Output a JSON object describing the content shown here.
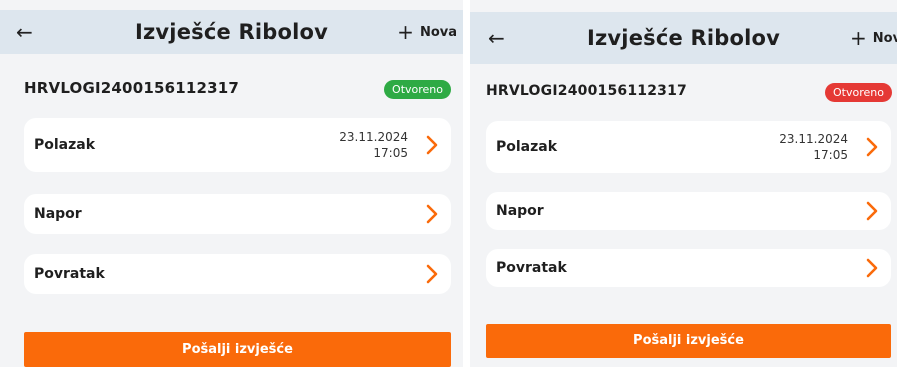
{
  "screens": [
    {
      "header": {
        "title": "Izvješće Ribolov",
        "new_label": "Nova",
        "back_icon": "arrow-left-icon",
        "plus_icon": "plus-icon"
      },
      "report": {
        "id": "HRVLOGI2400156112317",
        "status": "Otvoreno",
        "status_color": "#2eaa44"
      },
      "sections": [
        {
          "label": "Polazak",
          "date": "23.11.2024",
          "time": "17:05"
        },
        {
          "label": "Napor"
        },
        {
          "label": "Povratak"
        }
      ],
      "submit_label": "Pošalji izvješće"
    },
    {
      "header": {
        "title": "Izvješće Ribolov",
        "new_label": "Nova",
        "back_icon": "arrow-left-icon",
        "plus_icon": "plus-icon"
      },
      "report": {
        "id": "HRVLOGI2400156112317",
        "status": "Otvoreno",
        "status_color": "#e53935"
      },
      "sections": [
        {
          "label": "Polazak",
          "date": "23.11.2024",
          "time": "17:05"
        },
        {
          "label": "Napor"
        },
        {
          "label": "Povratak"
        }
      ],
      "submit_label": "Pošalji izvješće"
    }
  ],
  "colors": {
    "accent": "#fa6a0a",
    "header_bg": "#dde6ee",
    "page_bg": "#f3f4f6"
  }
}
